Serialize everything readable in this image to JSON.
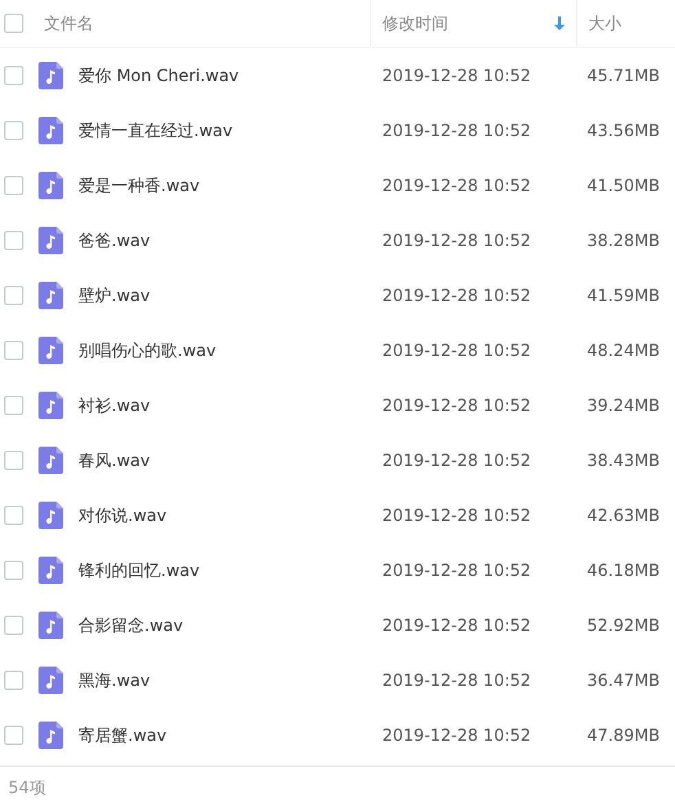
{
  "header": {
    "checked": false,
    "columns": [
      {
        "label": "文件名",
        "sorted": false
      },
      {
        "label": "修改时间",
        "sorted": true
      },
      {
        "label": "大小",
        "sorted": false
      }
    ]
  },
  "rows": [
    {
      "name": "爱你 Mon Cheri.wav",
      "modified": "2019-12-28 10:52",
      "size": "45.71MB",
      "checked": false
    },
    {
      "name": "爱情一直在经过.wav",
      "modified": "2019-12-28 10:52",
      "size": "43.56MB",
      "checked": false
    },
    {
      "name": "爱是一种香.wav",
      "modified": "2019-12-28 10:52",
      "size": "41.50MB",
      "checked": false
    },
    {
      "name": "爸爸.wav",
      "modified": "2019-12-28 10:52",
      "size": "38.28MB",
      "checked": false
    },
    {
      "name": "壁炉.wav",
      "modified": "2019-12-28 10:52",
      "size": "41.59MB",
      "checked": false
    },
    {
      "name": "别唱伤心的歌.wav",
      "modified": "2019-12-28 10:52",
      "size": "48.24MB",
      "checked": false
    },
    {
      "name": "衬衫.wav",
      "modified": "2019-12-28 10:52",
      "size": "39.24MB",
      "checked": false
    },
    {
      "name": "春风.wav",
      "modified": "2019-12-28 10:52",
      "size": "38.43MB",
      "checked": false
    },
    {
      "name": "对你说.wav",
      "modified": "2019-12-28 10:52",
      "size": "42.63MB",
      "checked": false
    },
    {
      "name": "锋利的回忆.wav",
      "modified": "2019-12-28 10:52",
      "size": "46.18MB",
      "checked": false
    },
    {
      "name": "合影留念.wav",
      "modified": "2019-12-28 10:52",
      "size": "52.92MB",
      "checked": false
    },
    {
      "name": "黑海.wav",
      "modified": "2019-12-28 10:52",
      "size": "36.47MB",
      "checked": false
    },
    {
      "name": "寄居蟹.wav",
      "modified": "2019-12-28 10:52",
      "size": "47.89MB",
      "checked": false
    }
  ],
  "status_bar": {
    "count": "54项"
  }
}
